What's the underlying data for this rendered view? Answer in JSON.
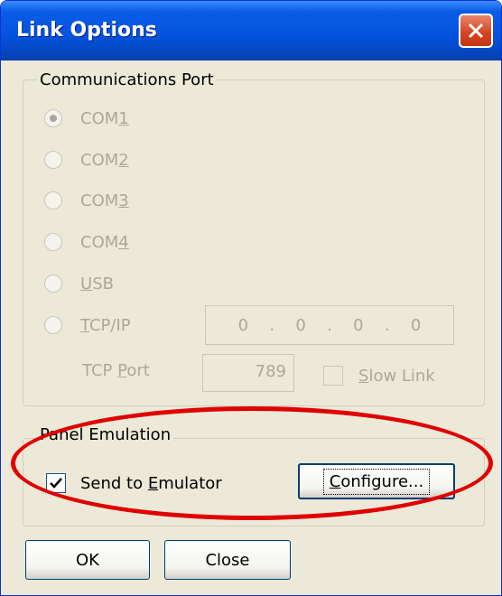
{
  "window": {
    "title": "Link Options",
    "close_icon": "close-x-icon",
    "titlebar_color": "#0454e0",
    "close_color": "#d5421f"
  },
  "comm_port": {
    "legend": "Communications Port",
    "options": [
      {
        "pre": "COM",
        "hot": "1",
        "post": "",
        "selected": true
      },
      {
        "pre": "COM",
        "hot": "2",
        "post": "",
        "selected": false
      },
      {
        "pre": "COM",
        "hot": "3",
        "post": "",
        "selected": false
      },
      {
        "pre": "COM",
        "hot": "4",
        "post": "",
        "selected": false
      },
      {
        "pre": "",
        "hot": "U",
        "post": "SB",
        "selected": false
      },
      {
        "pre": "",
        "hot": "T",
        "post": "CP/IP",
        "selected": false
      }
    ],
    "ip_octets": [
      "0",
      "0",
      "0",
      "0"
    ],
    "ip_separator": ".",
    "tcp_port_label_pre": "TCP ",
    "tcp_port_label_hot": "P",
    "tcp_port_label_post": "ort",
    "tcp_port_value": "789",
    "slow_link_hot": "S",
    "slow_link_post": "low Link",
    "slow_link_checked": false
  },
  "panel_emulation": {
    "legend": "Panel Emulation",
    "send_label_pre": "Send to ",
    "send_label_hot": "E",
    "send_label_post": "mulator",
    "send_checked": true,
    "configure_hot": "C",
    "configure_post": "onfigure..."
  },
  "buttons": {
    "ok": "OK",
    "close": "Close"
  },
  "annotation_color": "#e00000"
}
